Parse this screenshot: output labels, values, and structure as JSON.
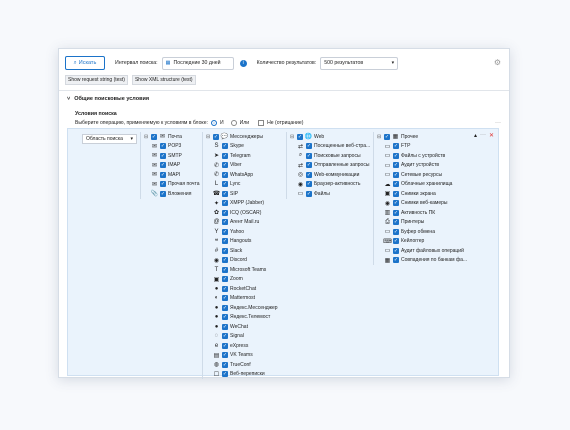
{
  "toolbar": {
    "search_label": "Искать",
    "period_label": "Интервал поиска:",
    "period_value": "Последние 30 дней",
    "count_label": "Количество результатов:",
    "count_value": "500 результатов"
  },
  "test_buttons": [
    "Show request string (test)",
    "Show XML structure (test)"
  ],
  "section_title": "Общие поисковые условия",
  "conditions_title": "Условия поиска",
  "operation": {
    "label": "Выберите операцию, применяемую к условиям в блоке:",
    "and": "И",
    "or": "Или",
    "not": "Не (отрицание)"
  },
  "area_label": "Область поиска",
  "columns": [
    {
      "header": "Почта",
      "icon": "✉",
      "items": [
        {
          "label": "POP3",
          "icon": "✉"
        },
        {
          "label": "SMTP",
          "icon": "✉"
        },
        {
          "label": "IMAP",
          "icon": "✉"
        },
        {
          "label": "MAPI",
          "icon": "✉"
        },
        {
          "label": "Прочая почта",
          "icon": "✉"
        },
        {
          "label": "Вложения",
          "icon": "📎"
        }
      ]
    },
    {
      "header": "Мессенджеры",
      "icon": "💬",
      "items": [
        {
          "label": "Skype",
          "icon": "S"
        },
        {
          "label": "Telegram",
          "icon": "➤"
        },
        {
          "label": "Viber",
          "icon": "✆"
        },
        {
          "label": "WhatsApp",
          "icon": "✆"
        },
        {
          "label": "Lync",
          "icon": "L"
        },
        {
          "label": "SIP",
          "icon": "☎"
        },
        {
          "label": "XMPP (Jabber)",
          "icon": "✦"
        },
        {
          "label": "ICQ (OSCAR)",
          "icon": "✿"
        },
        {
          "label": "Агент Mail.ru",
          "icon": "@"
        },
        {
          "label": "Yahoo",
          "icon": "Y"
        },
        {
          "label": "Hangouts",
          "icon": "❝"
        },
        {
          "label": "Slack",
          "icon": "#"
        },
        {
          "label": "Discord",
          "icon": "◉"
        },
        {
          "label": "Microsoft Teams",
          "icon": "T"
        },
        {
          "label": "Zoom",
          "icon": "▣"
        },
        {
          "label": "RocketChat",
          "icon": "●"
        },
        {
          "label": "Mattermost",
          "icon": "◐"
        },
        {
          "label": "Яндекс.Мессенджер",
          "icon": "●"
        },
        {
          "label": "Яндекс.Телемост",
          "icon": "●"
        },
        {
          "label": "WeChat",
          "icon": "●"
        },
        {
          "label": "Signal",
          "icon": "◌"
        },
        {
          "label": "eXpress",
          "icon": "e"
        },
        {
          "label": "VK Teams",
          "icon": "▤"
        },
        {
          "label": "TrueConf",
          "icon": "◍"
        },
        {
          "label": "Веб-переписки",
          "icon": "☐"
        }
      ]
    },
    {
      "header": "Web",
      "icon": "🌐",
      "items": [
        {
          "label": "Посещенные веб-стра...",
          "icon": "⇄"
        },
        {
          "label": "Поисковые запросы",
          "icon": "⌕"
        },
        {
          "label": "Отправленные запросы",
          "icon": "⇄"
        },
        {
          "label": "Web-коммуникации",
          "icon": "◎"
        },
        {
          "label": "Браузер-активность",
          "icon": "◉"
        },
        {
          "label": "Файлы",
          "icon": "▭"
        }
      ]
    },
    {
      "header": "Прочее",
      "icon": "▦",
      "items": [
        {
          "label": "FTP",
          "icon": "▭"
        },
        {
          "label": "Файлы с устройств",
          "icon": "▭"
        },
        {
          "label": "Аудит устройств",
          "icon": "▭"
        },
        {
          "label": "Сетевые ресурсы",
          "icon": "▭"
        },
        {
          "label": "Облачные хранилища",
          "icon": "☁"
        },
        {
          "label": "Снимки экрана",
          "icon": "▣"
        },
        {
          "label": "Снимки веб-камеры",
          "icon": "◉"
        },
        {
          "label": "Активность ПК",
          "icon": "▥"
        },
        {
          "label": "Принтеры",
          "icon": "⎙"
        },
        {
          "label": "Буфер обмена",
          "icon": "▭"
        },
        {
          "label": "Кейлоггер",
          "icon": "⌨"
        },
        {
          "label": "Аудит файловых операций",
          "icon": "▭"
        },
        {
          "label": "Совпадения по банкам фа...",
          "icon": "▦"
        }
      ]
    }
  ],
  "colors": {
    "accent": "#1b73c9",
    "panel_bg": "#eaf3fc",
    "delete": "#e0322f"
  }
}
